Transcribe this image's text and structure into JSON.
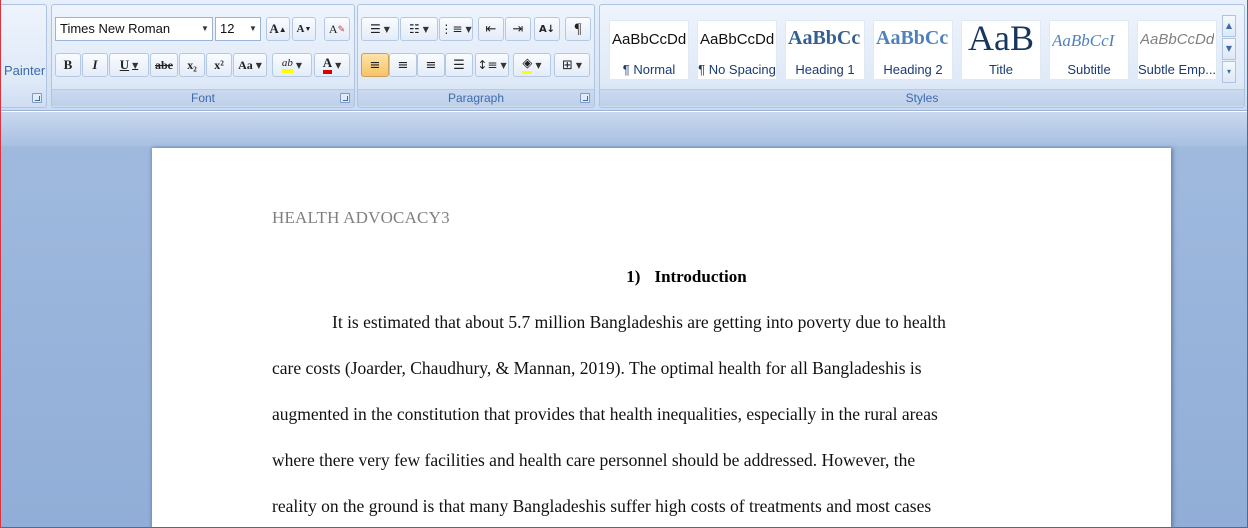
{
  "ribbon": {
    "clipboard": {
      "painter_label": "Painter"
    },
    "font": {
      "group_label": "Font",
      "font_name": "Times New Roman",
      "font_size": "12",
      "grow_label": "A",
      "shrink_label": "A",
      "clear_label": "A",
      "bold_label": "B",
      "italic_label": "I",
      "underline_label": "U",
      "strike_label": "abe",
      "subscript_label": "x₂",
      "superscript_label": "x²",
      "case_label": "Aa",
      "highlight_label": "ab",
      "font_color_label": "A"
    },
    "paragraph": {
      "group_label": "Paragraph",
      "pilcrow": "¶"
    },
    "styles": {
      "group_label": "Styles",
      "tiles": [
        {
          "sample": "AaBbCcDd",
          "name": "¶ Normal"
        },
        {
          "sample": "AaBbCcDd",
          "name": "¶ No Spacing"
        },
        {
          "sample": "AaBbCc",
          "name": "Heading 1"
        },
        {
          "sample": "AaBbCc",
          "name": "Heading 2"
        },
        {
          "sample": "AaB",
          "name": "Title"
        },
        {
          "sample": "AaBbCcI",
          "name": "Subtitle"
        },
        {
          "sample": "AaBbCcDd",
          "name": "Subtle Emp..."
        }
      ]
    }
  },
  "document": {
    "running_head": "HEALTH ADVOCACY3",
    "heading_number": "1)",
    "heading_text": "Introduction",
    "lines": [
      "It is estimated that about 5.7 million Bangladeshis are getting into poverty due to health",
      "care costs (Joarder, Chaudhury, & Mannan, 2019). The optimal health for all Bangladeshis is",
      "augmented in the constitution that provides that health inequalities, especially in the rural areas",
      "where there very few facilities and health care personnel should be addressed. However, the",
      "reality on the ground is that many Bangladeshis suffer high costs of treatments and most cases"
    ]
  },
  "colors": {
    "accent_active": "#f7c466",
    "ribbon_text": "#3e6aaa",
    "highlight_yellow": "#ffff00",
    "font_color_red": "#e00000"
  }
}
